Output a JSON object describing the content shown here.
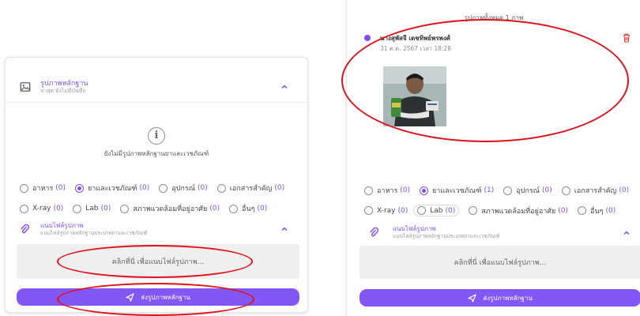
{
  "left": {
    "section1": {
      "title": "รูปภาพหลักฐาน",
      "subtitle": "ล่าสุด ยังไม่มีบันทึก",
      "icon": "image-icon"
    },
    "empty": {
      "text": "ยังไม่มีรูปภาพหลักฐานยาและเวชภัณฑ์",
      "icon": "info-icon"
    },
    "radios_row1": [
      {
        "label": "อาหาร",
        "count": "(0)",
        "checked": false
      },
      {
        "label": "ยาและเวชภัณฑ์",
        "count": "(0)",
        "checked": true
      },
      {
        "label": "อุปกรณ์",
        "count": "(0)",
        "checked": false
      },
      {
        "label": "เอกสารสำคัญ",
        "count": "(0)",
        "checked": false
      }
    ],
    "radios_row2": [
      {
        "label": "X-ray",
        "count": "(0)",
        "checked": false
      },
      {
        "label": "Lab",
        "count": "(0)",
        "checked": false
      },
      {
        "label": "สภาพแวดล้อมที่อยู่อาศัย",
        "count": "(0)",
        "checked": false
      },
      {
        "label": "อื่นๆ",
        "count": "(0)",
        "checked": false
      }
    ],
    "attach": {
      "title": "แนบไฟล์รูปภาพ",
      "subtitle": "แนบไฟล์รูปภาพหลักฐานประเภทยาและเวชภัณฑ์"
    },
    "dropzone_text": "คลิกที่นี่ เพื่อแนบไฟล์รูปภาพ...",
    "send_label": "ส่งรูปภาพหลักฐาน"
  },
  "right": {
    "header_text": "รูปภาพทั้งหมด 1 ภาพ",
    "post": {
      "author": "นางสุพัสจี เดชทิพย์พรพงศ์",
      "datetime": "31 ต.ค. 2567 เวลา 18:28"
    },
    "radios_row1": [
      {
        "label": "อาหาร",
        "count": "(0)",
        "checked": false
      },
      {
        "label": "ยาและเวชภัณฑ์",
        "count": "(1)",
        "checked": true
      },
      {
        "label": "อุปกรณ์",
        "count": "(0)",
        "checked": false
      },
      {
        "label": "เอกสารสำคัญ",
        "count": "(0)",
        "checked": false
      }
    ],
    "radios_row2": [
      {
        "label": "X-ray",
        "count": "(0)",
        "checked": false
      },
      {
        "label": "Lab",
        "count": "(0)",
        "checked": false
      },
      {
        "label": "สภาพแวดล้อมที่อยู่อาศัย",
        "count": "(0)",
        "checked": false
      },
      {
        "label": "อื่นๆ",
        "count": "(0)",
        "checked": false
      }
    ],
    "attach": {
      "title": "แนบไฟล์รูปภาพ",
      "subtitle": "แนบไฟล์รูปภาพหลักฐานประเภทยาและเวชภัณฑ์"
    },
    "dropzone_text": "คลิกที่นี่ เพื่อแนบไฟล์รูปภาพ...",
    "send_label": "ส่งรูปภาพหลักฐาน"
  },
  "colors": {
    "accent": "#7c4dff",
    "button": "#8257f5",
    "annotation": "#e0101a",
    "delete": "#e53935"
  }
}
